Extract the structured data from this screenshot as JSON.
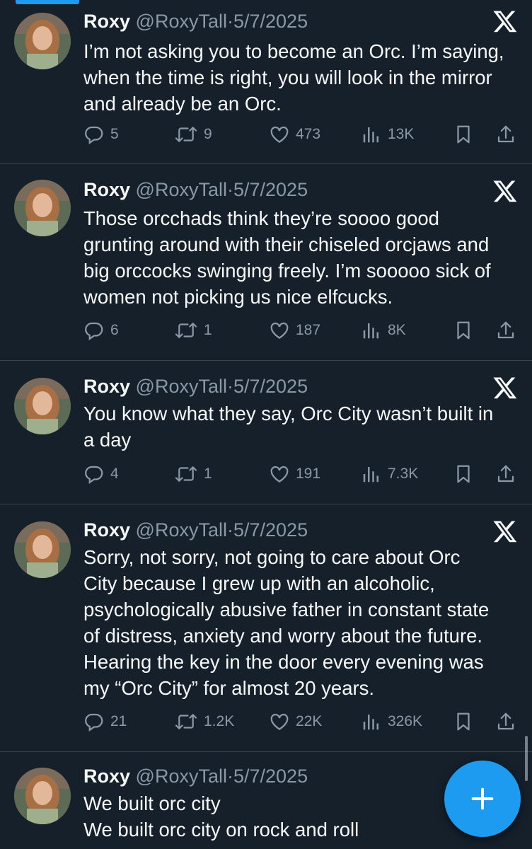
{
  "tweets": [
    {
      "name": "Roxy",
      "handle": "@RoxyTall",
      "sep": "·",
      "date": "5/7/2025",
      "lines": [
        "I’m not asking you to become an Orc. I’m saying,",
        "when the time is right, you will look in the mirror",
        "and already be an Orc."
      ],
      "replies": "5",
      "reposts": "9",
      "likes": "473",
      "views": "13K"
    },
    {
      "name": "Roxy",
      "handle": "@RoxyTall",
      "sep": "·",
      "date": "5/7/2025",
      "lines": [
        "Those orcchads think they’re soooo good",
        "grunting around with their chiseled orcjaws and",
        "big orccocks swinging freely. I’m sooooo sick of",
        "women not picking us nice elfcucks."
      ],
      "replies": "6",
      "reposts": "1",
      "likes": "187",
      "views": "8K"
    },
    {
      "name": "Roxy",
      "handle": "@RoxyTall",
      "sep": "·",
      "date": "5/7/2025",
      "lines": [
        "You know what they say, Orc City wasn’t built in",
        "a day"
      ],
      "replies": "4",
      "reposts": "1",
      "likes": "191",
      "views": "7.3K"
    },
    {
      "name": "Roxy",
      "handle": "@RoxyTall",
      "sep": "·",
      "date": "5/7/2025",
      "lines": [
        "Sorry, not sorry, not going to care about Orc",
        "City because I grew up with an alcoholic,",
        "psychologically abusive father in constant state",
        "of distress, anxiety and worry about the future.",
        "Hearing the key in the door every evening was",
        "my “Orc City” for almost 20 years."
      ],
      "replies": "21",
      "reposts": "1.2K",
      "likes": "22K",
      "views": "326K"
    },
    {
      "name": "Roxy",
      "handle": "@RoxyTall",
      "sep": "·",
      "date": "5/7/2025",
      "lines": [
        "We built orc city",
        "We built orc city on rock and roll"
      ]
    }
  ],
  "colors": {
    "background": "#15202b",
    "text": "#f7f9f9",
    "muted": "#8b98a5",
    "accent": "#1d9bf0",
    "divider": "#38444d"
  },
  "icons": [
    "reply-icon",
    "repost-icon",
    "like-icon",
    "views-icon",
    "bookmark-icon",
    "share-icon",
    "x-logo-icon",
    "compose-plus-icon"
  ]
}
